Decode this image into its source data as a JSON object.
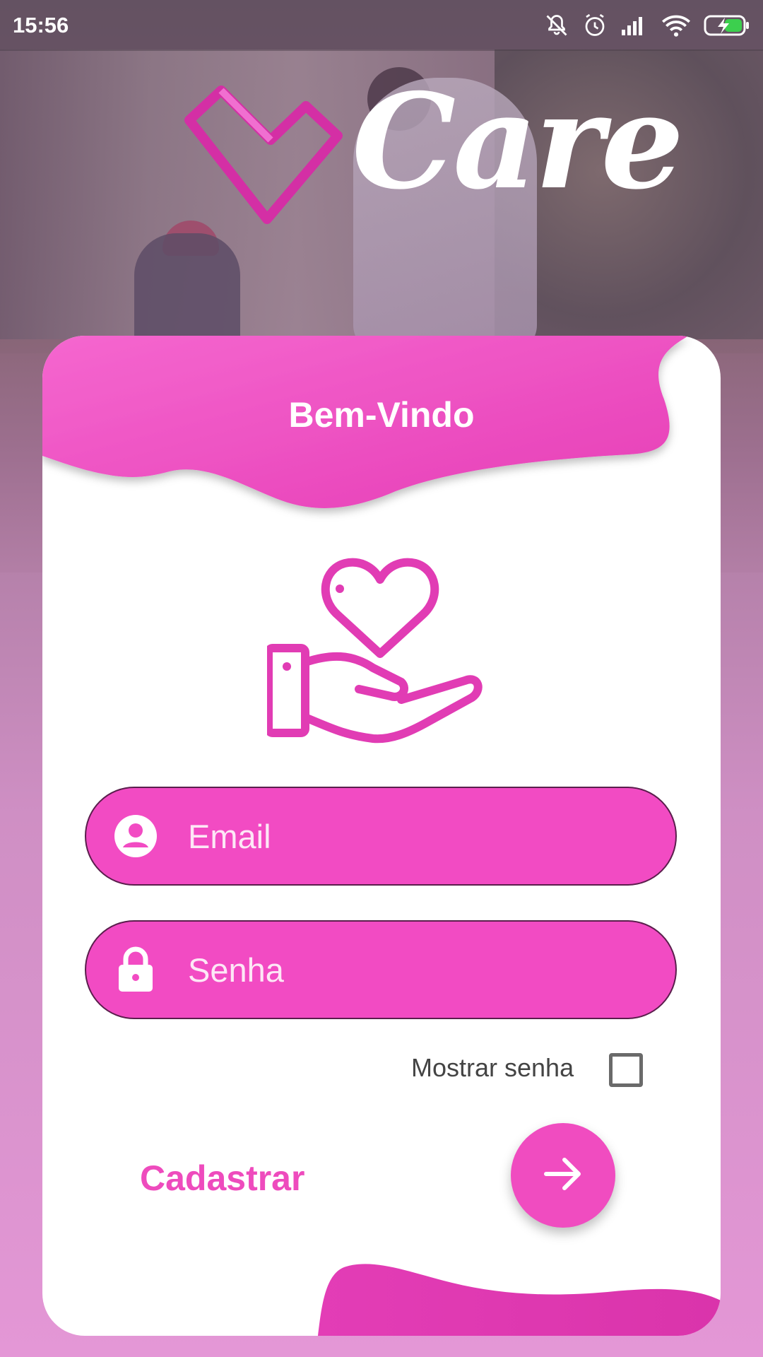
{
  "status_bar": {
    "time": "15:56",
    "icons": [
      "bell-off-icon",
      "alarm-icon",
      "signal-icon",
      "wifi-icon",
      "battery-charging-icon"
    ]
  },
  "logo": {
    "text": "Care",
    "icon": "heart-logo-icon"
  },
  "card": {
    "title": "Bem-Vindo",
    "illustration": "hand-heart-icon",
    "email": {
      "placeholder": "Email",
      "value": "",
      "icon": "user-icon"
    },
    "password": {
      "placeholder": "Senha",
      "value": "",
      "icon": "lock-icon"
    },
    "show_password": {
      "label": "Mostrar senha",
      "checked": false
    },
    "register_label": "Cadastrar",
    "submit_icon": "arrow-right-icon"
  },
  "colors": {
    "accent": "#f04cc0",
    "accent_dark": "#d936ad",
    "field_border": "#5a1e4c"
  }
}
